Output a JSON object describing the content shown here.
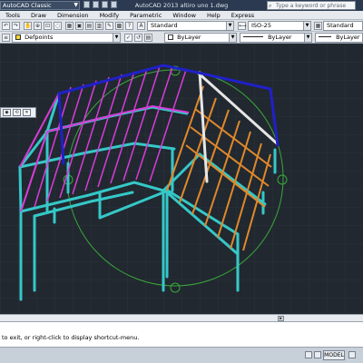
{
  "titlebar": {
    "workspace": "AutoCAD Classic",
    "app_title": "AutoCAD 2013   altiro uno 1.dwg",
    "search_placeholder": "Type a keyword or phrase"
  },
  "menubar": {
    "items": [
      "Tools",
      "Draw",
      "Dimension",
      "Modify",
      "Parametric",
      "Window",
      "Help",
      "Express"
    ]
  },
  "toolbar": {
    "text_style": "Standard",
    "dim_style": "ISO-25",
    "table_style": "Standard",
    "layer": "Defpoints",
    "color": "ByLayer",
    "linetype": "ByLayer",
    "lineweight": "ByLayer"
  },
  "command_line": {
    "text": "to exit, or right-click to display shortcut-menu."
  },
  "statusbar": {
    "model_label": "MODEL"
  },
  "colors": {
    "background": "#212830",
    "grid": "#2d3540",
    "frame_cyan": "#35c8c8",
    "truss_magenta": "#d83cd8",
    "purlin_orange": "#e0892a",
    "ridge_white": "#e6e6e6",
    "edge_blue": "#2020c8",
    "orbit_green": "#3aa83a"
  }
}
